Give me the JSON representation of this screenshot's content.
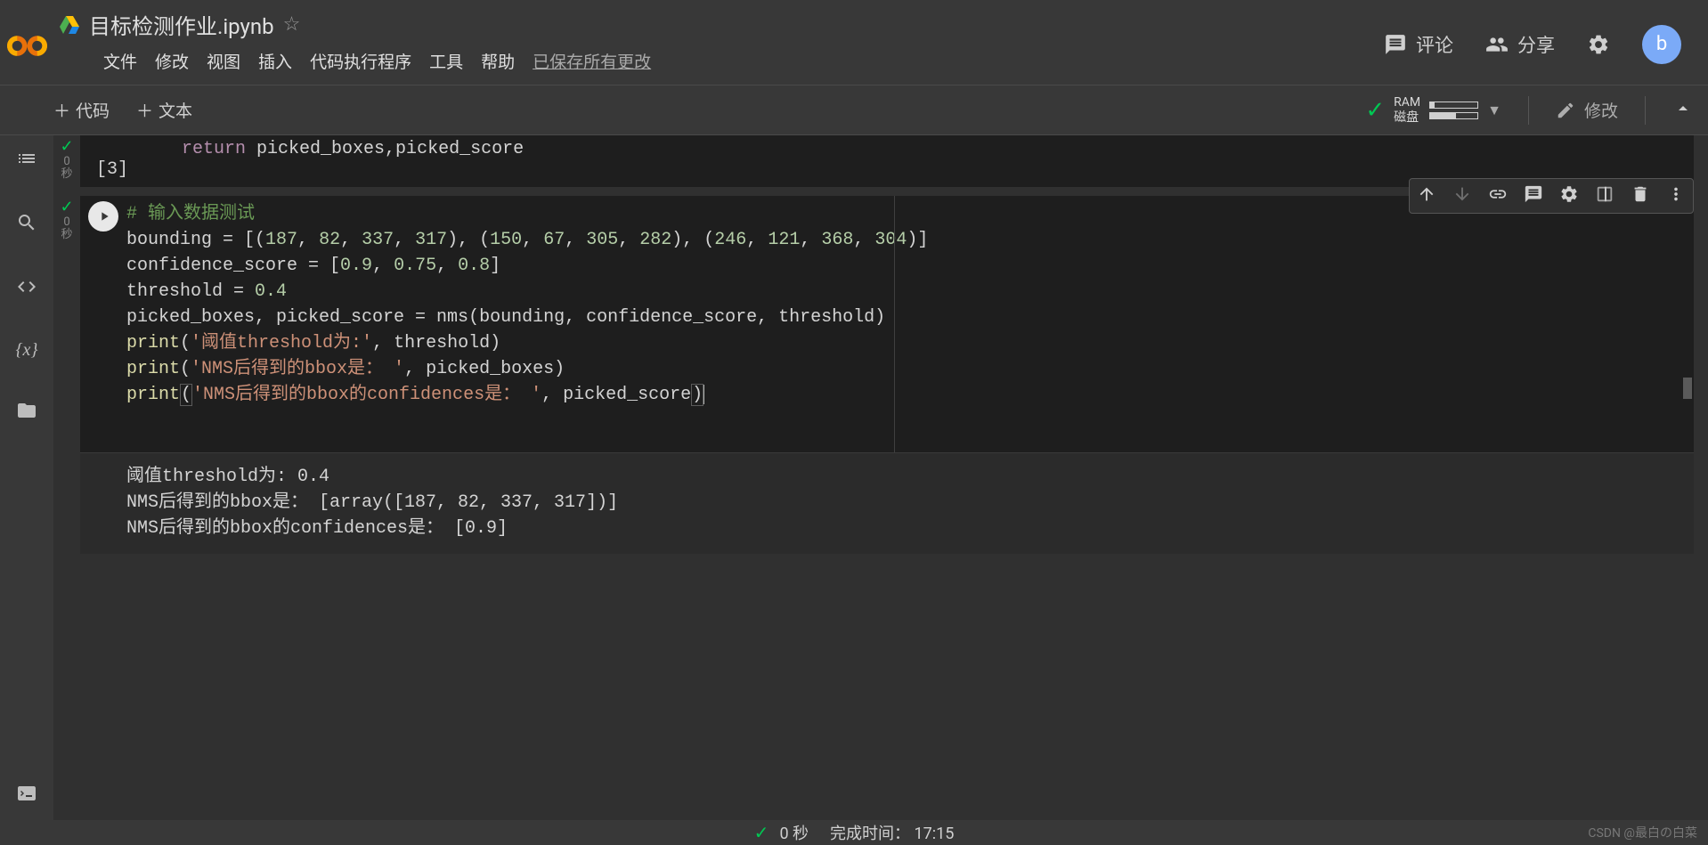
{
  "header": {
    "title": "目标检测作业.ipynb",
    "menu": [
      "文件",
      "修改",
      "视图",
      "插入",
      "代码执行程序",
      "工具",
      "帮助"
    ],
    "saved_note": "已保存所有更改",
    "actions": {
      "comment": "评论",
      "share": "分享"
    },
    "avatar_letter": "b"
  },
  "subheader": {
    "add_code": "代码",
    "add_text": "文本",
    "ram_label": "RAM",
    "disk_label": "磁盘",
    "edit_label": "修改"
  },
  "prev_cell": {
    "code_line": "    return  picked_boxes,picked_score",
    "out_label": "[3]",
    "exec_time": "0",
    "exec_unit": "秒"
  },
  "active_cell": {
    "exec_time": "0",
    "exec_unit": "秒",
    "comment": "#  输入数据测试",
    "code": {
      "l2_pre": "bounding  =  [(",
      "l2_nums": [
        "187",
        "82",
        "337",
        "317",
        "150",
        "67",
        "305",
        "282",
        "246",
        "121",
        "368",
        "304"
      ],
      "l3_pre": "confidence_score  =  [",
      "l3_nums": [
        "0.9",
        "0.75",
        "0.8"
      ],
      "l4_pre": "threshold  =  ",
      "l4_num": "0.4",
      "l5": "picked_boxes,  picked_score  =  nms(bounding,  confidence_score,  threshold)",
      "l6_str": "'阈值threshold为:'",
      "l6_tail": ",  threshold)",
      "l7_str": "'NMS后得到的bbox是： '",
      "l7_tail": ",  picked_boxes)",
      "l8_str": "'NMS后得到的bbox的confidences是： '",
      "l8_tail": ",  picked_score)"
    },
    "output": [
      "阈值threshold为: 0.4",
      "NMS后得到的bbox是：  [array([187,  82, 337, 317])]",
      "NMS后得到的bbox的confidences是：  [0.9]"
    ]
  },
  "status": {
    "exec_time": "0 秒",
    "completion_label": "完成时间： 17:15"
  },
  "watermark": "CSDN @最白の白菜"
}
